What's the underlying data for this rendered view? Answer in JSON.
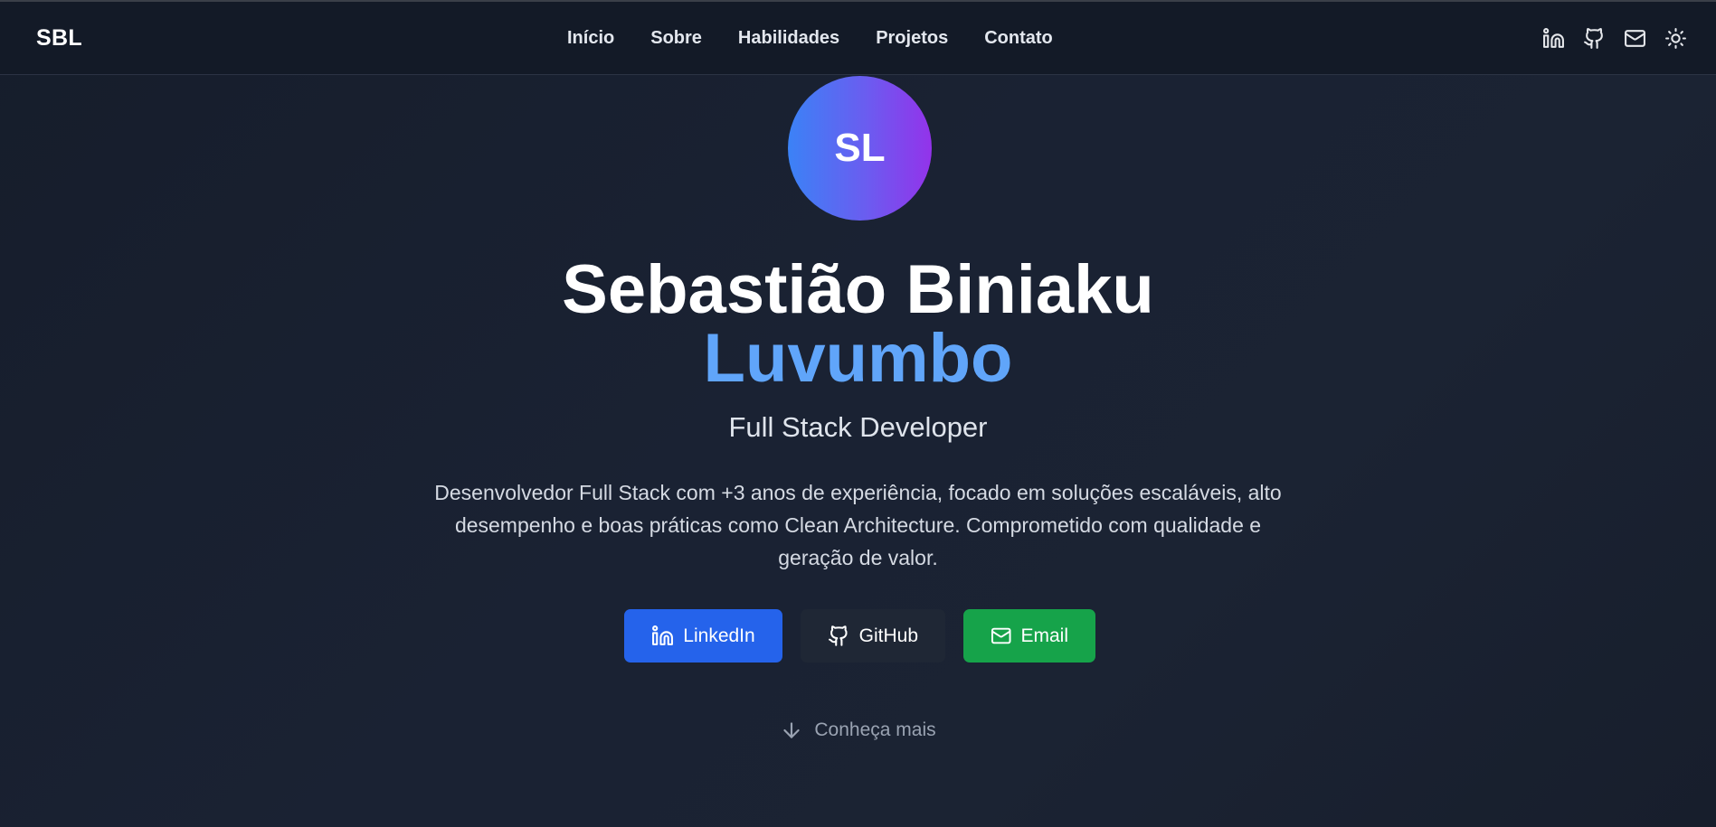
{
  "header": {
    "logo": "SBL",
    "nav": [
      "Início",
      "Sobre",
      "Habilidades",
      "Projetos",
      "Contato"
    ],
    "icons": [
      "linkedin-icon",
      "github-icon",
      "mail-icon",
      "sun-icon"
    ]
  },
  "hero": {
    "avatar_initials": "SL",
    "name_first": "Sebastião Biniaku",
    "name_last": "Luvumbo",
    "role": "Full Stack Developer",
    "bio": "Desenvolvedor Full Stack com +3 anos de experiência, focado em soluções escaláveis, alto desempenho e boas práticas como Clean Architecture. Comprometido com qualidade e geração de valor.",
    "buttons": {
      "linkedin": "LinkedIn",
      "github": "GitHub",
      "email": "Email"
    },
    "more": "Conheça mais"
  },
  "colors": {
    "accent_blue": "#60a5fa",
    "linkedin_button": "#2563eb",
    "github_button": "#1f2735",
    "email_button": "#16a34a",
    "background": "#1a2233"
  }
}
